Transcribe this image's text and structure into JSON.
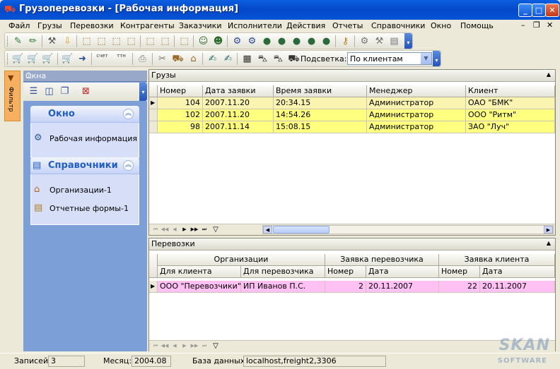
{
  "window": {
    "title": "Грузоперевозки - [Рабочая информация]"
  },
  "menu": [
    "Файл",
    "Грузы",
    "Перевозки",
    "Контрагенты",
    "Заказчики",
    "Исполнители",
    "Действия",
    "Отчеты",
    "Справочники",
    "Окно",
    "Помощь"
  ],
  "toolbar2": {
    "highlight_label": "Подсветка:",
    "highlight_value": "По клиентам",
    "btn_schet": "счет",
    "btn_ttn": "ттн"
  },
  "sidebar": {
    "header": "Окна",
    "filter_tab": "Фильтр",
    "group_window": {
      "title": "Окно",
      "items": [
        "Рабочая информация"
      ]
    },
    "group_refs": {
      "title": "Справочники",
      "items": [
        "Организации-1",
        "Отчетные формы-1"
      ]
    }
  },
  "cargo": {
    "title": "Грузы",
    "columns": [
      "Номер",
      "Дата заявки",
      "Время заявки",
      "Менеджер",
      "Клиент"
    ],
    "rows": [
      {
        "num": "104",
        "date": "2007.11.20",
        "time": "20:34.15",
        "manager": "Администратор",
        "client": "ОАО \"БМК\""
      },
      {
        "num": "102",
        "date": "2007.11.20",
        "time": "14:54.26",
        "manager": "Администратор",
        "client": "ООО \"Ритм\""
      },
      {
        "num": "98",
        "date": "2007.11.14",
        "time": "15:08.15",
        "manager": "Администратор",
        "client": "ЗАО \"Луч\""
      }
    ]
  },
  "transport": {
    "title": "Перевозки",
    "band_org": "Организации",
    "band_carrier": "Заявка перевозчика",
    "band_client": "Заявка клиента",
    "columns": [
      "Для клиента",
      "Для перевозчика",
      "Номер",
      "Дата",
      "Номер",
      "Дата"
    ],
    "rows": [
      {
        "for_client": "ООО \"Перевозчики\"",
        "for_carrier": "ИП Иванов П.С.",
        "c_num": "2",
        "c_date": "20.11.2007",
        "k_num": "22",
        "k_date": "20.11.2007"
      }
    ]
  },
  "status": {
    "records_label": "Записей:",
    "records": "3",
    "month_label": "Месяц:",
    "month": "2004.08",
    "db_label": "База данных:",
    "db": "localhost,freight2,3306"
  },
  "watermark": {
    "logo": "SKAN",
    "sub": "SOFTWARE"
  }
}
